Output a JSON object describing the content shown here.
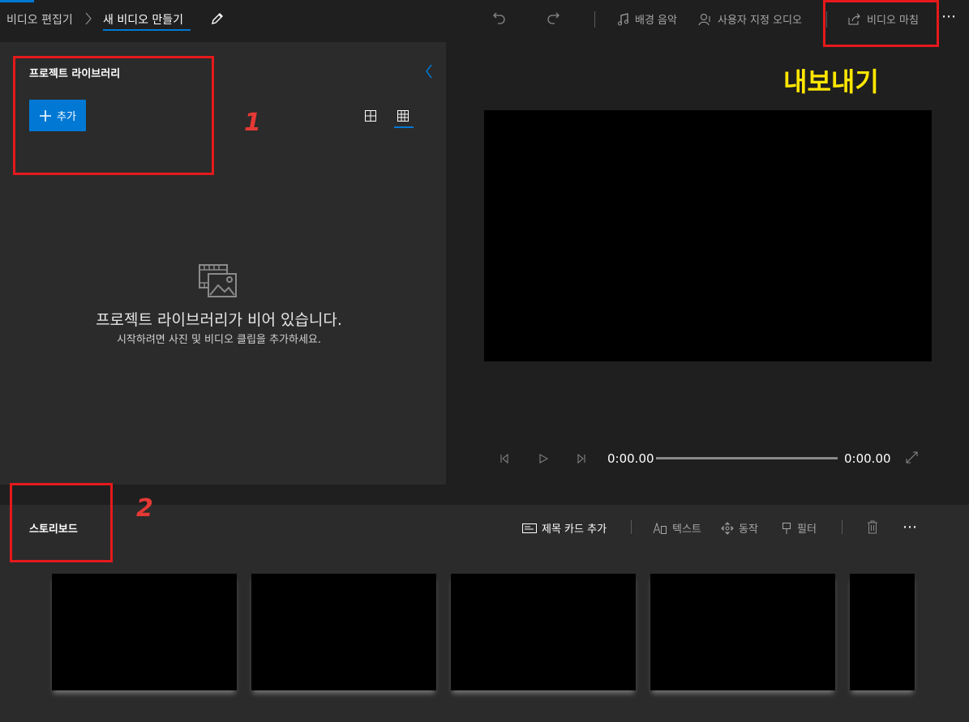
{
  "breadcrumb": {
    "root": "비디오 편집기",
    "current": "새 비디오 만들기"
  },
  "toolbar": {
    "background_music": "배경 음악",
    "custom_audio": "사용자 지정 오디오",
    "finish_video": "비디오 마침"
  },
  "library": {
    "title": "프로젝트 라이브러리",
    "add_label": "추가",
    "empty_title": "프로젝트 라이브러리가 비어 있습니다.",
    "empty_subtitle": "시작하려면 사진 및 비디오 클립을 추가하세요."
  },
  "player": {
    "current_time": "0:00.00",
    "total_time": "0:00.00",
    "progress": 0
  },
  "storyboard": {
    "title": "스토리보드",
    "add_title_card": "제목 카드 추가",
    "text": "텍스트",
    "motion": "동작",
    "filter": "필터"
  },
  "annotations": {
    "label_1": "1",
    "label_2": "2",
    "export_label": "내보내기"
  },
  "colors": {
    "accent": "#0078d4",
    "annotation_red": "#e5191b",
    "annotation_yellow": "#ffe600"
  }
}
